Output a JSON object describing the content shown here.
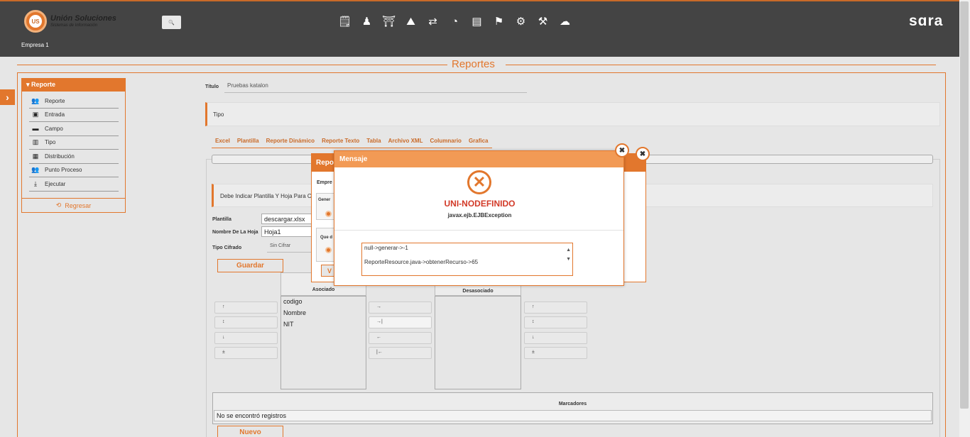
{
  "header": {
    "logo_title": "Unión Soluciones",
    "logo_sub": "Sistemas de Información",
    "logo_mark": "US",
    "company": "Empresa 1",
    "brand": "sɑra",
    "search_icon": "🔍",
    "toolbar_icons": [
      "report-icon",
      "users-icon",
      "gift-icon",
      "tree-icon",
      "exchange-icon",
      "timer-icon",
      "document-icon",
      "board-icon",
      "network-icon",
      "settings-icon",
      "group-icon"
    ]
  },
  "page": {
    "title": "Reportes"
  },
  "menu": {
    "header": "Reporte",
    "items": [
      {
        "label": "Reporte",
        "icon": "group-icon"
      },
      {
        "label": "Entrada",
        "icon": "computer-icon"
      },
      {
        "label": "Campo",
        "icon": "field-icon"
      },
      {
        "label": "Tipo",
        "icon": "file-icon"
      },
      {
        "label": "Distribución",
        "icon": "chart-icon"
      },
      {
        "label": "Punto Proceso",
        "icon": "group-icon"
      },
      {
        "label": "Ejecutar",
        "icon": "download-icon"
      }
    ],
    "back_label": "Regresar"
  },
  "form": {
    "titulo_label": "Título",
    "titulo_value": "Pruebas katalon",
    "tipo_label": "Tipo",
    "tabs": [
      "Excel",
      "Plantilla",
      "Reporte Dinámico",
      "Reporte Texto",
      "Tabla",
      "Archivo XML",
      "Columnario",
      "Grafica"
    ],
    "warning": "Debe Indicar Plantilla Y Hoja Para C",
    "plantilla_label": "Plantilla",
    "plantilla_value": "descargar.xlsx",
    "hoja_label": "Nombre De La Hoja",
    "hoja_value": "Hoja1",
    "cifrado_label": "Tipo Cifrado",
    "cifrado_value": "Sin Cifrar",
    "guardar": "Guardar",
    "nuevo": "Nuevo"
  },
  "lists": {
    "asociado_header": "Asociado",
    "desasociado_header": "Desasociado",
    "asociado_items": [
      "codigo",
      "Nombre",
      "NIT"
    ],
    "left_arrows": [
      "↑",
      "↕",
      "↓",
      "±"
    ],
    "middle_arrows": [
      "→",
      "→|",
      "←",
      "|←"
    ],
    "right_arrows": [
      "↑",
      "↕",
      "↓",
      "±"
    ]
  },
  "table": {
    "header": "Marcadores",
    "empty": "No se encontró registros"
  },
  "modal_under": {
    "title": "Repo",
    "empresa_label": "Empre",
    "gener_label": "Gener",
    "que_label": "Que d",
    "btn_label": "V"
  },
  "modal": {
    "title": "Mensaje",
    "error_title": "UNI-NODEFINIDO",
    "error_sub": "javax.ejb.EJBException",
    "detail_lines": [
      "null->generar->-1",
      "ReporteResource.java->obtenerRecurso->65"
    ]
  }
}
